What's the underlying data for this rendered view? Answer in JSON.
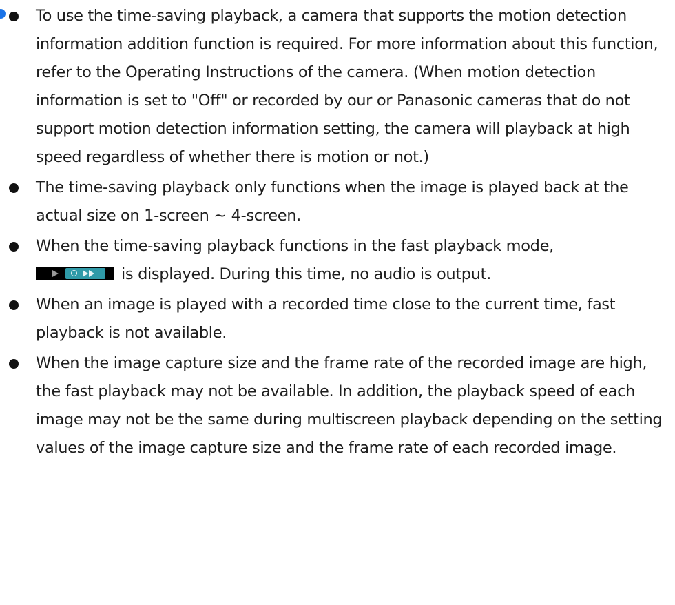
{
  "notes": [
    {
      "text": "To use the time-saving playback, a camera that supports the motion detection information addition function is required. For more information about this function, refer to the Operating Instructions of the camera. (When motion detection information is set to \"Off\" or recorded by our or Panasonic cameras that do not support motion detection information setting, the camera will playback at high speed regardless of whether there is motion or not.)"
    },
    {
      "text": "The time-saving playback only functions when the image is played back at the actual size on 1-screen ~ 4-screen."
    },
    {
      "text_before": "When the time-saving playback functions in the fast playback mode,",
      "icon": "time-saving-fast-playback-indicator-icon",
      "text_after": "is displayed. During this time, no audio is output."
    },
    {
      "text": "When an image is played with a recorded time close to the current time, fast playback is not available."
    },
    {
      "text": "When the image capture size and the frame rate of the recorded image are high, the fast playback may not be available. In addition, the playback speed of each image may not be the same during multiscreen playback depending on the setting values of the image capture size and the frame rate of each recorded image."
    }
  ],
  "colors": {
    "text": "#1e1e1e",
    "bullet": "#111111",
    "marker_dot": "#1a73e8",
    "indicator_background": "#000000",
    "indicator_fast_box": "#2f9aa8"
  }
}
